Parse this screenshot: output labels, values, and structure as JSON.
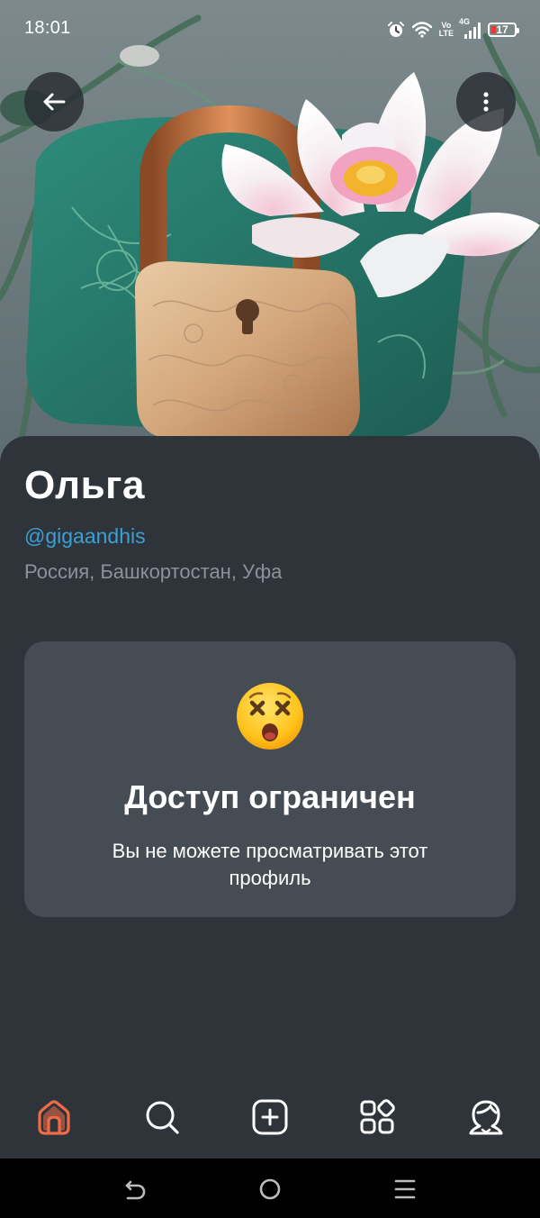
{
  "status_bar": {
    "time": "18:01",
    "network": "4G",
    "volte_top": "Vo",
    "volte_bottom": "LTE",
    "battery_level": "17",
    "battery_color": "#e53935",
    "icons": [
      "alarm-icon",
      "wifi-icon",
      "volte-icon",
      "signal-icon",
      "battery-icon"
    ]
  },
  "header": {
    "back_icon": "arrow-left-icon",
    "more_icon": "more-vertical-icon"
  },
  "cover": {
    "subject": "padlock-with-water-lily"
  },
  "profile": {
    "name": "Ольга",
    "handle": "@gigaandhis",
    "location": "Россия, Башкортостан, Уфа",
    "handle_color": "#3aa0d6"
  },
  "restricted": {
    "emoji_icon": "dizzy-face-emoji",
    "title": "Доступ ограничен",
    "message": "Вы не можете просматривать этот профиль"
  },
  "tabbar": {
    "active_color": "#f26b45",
    "items": [
      {
        "icon": "home-icon",
        "active": true
      },
      {
        "icon": "search-icon",
        "active": false
      },
      {
        "icon": "add-post-icon",
        "active": false
      },
      {
        "icon": "services-icon",
        "active": false
      },
      {
        "icon": "profile-icon",
        "active": false
      }
    ]
  },
  "system_nav": {
    "items": [
      "back-nav-icon",
      "home-nav-icon",
      "recents-nav-icon"
    ]
  }
}
